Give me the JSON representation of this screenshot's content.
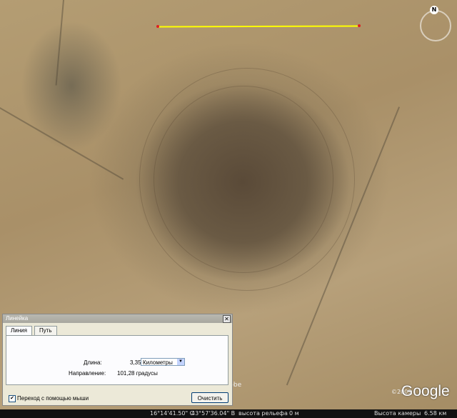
{
  "map": {
    "imagery_credit": "ital Globe",
    "logo": "Google",
    "copyright": "©2009"
  },
  "compass": {
    "north_label": "N"
  },
  "status_bar": {
    "latitude": "16°14'41.50\" С",
    "longitude": "43°57'36.04\" В",
    "elevation_label": "высота рельефа",
    "elevation_value": "0 м",
    "eye_alt_label": "Высота камеры",
    "eye_alt_value": "6.58 км"
  },
  "ruler_dialog": {
    "title": "Линейка",
    "close_glyph": "✕",
    "tabs": [
      {
        "label": "Линия"
      },
      {
        "label": "Путь"
      }
    ],
    "length_label": "Длина:",
    "length_value": "3,35",
    "unit_selected": "Километры",
    "direction_label": "Направление:",
    "direction_value": "101,28 градусы",
    "mouse_nav_label": "Переход с помощью мыши",
    "mouse_nav_checked": true,
    "clear_button": "Очистить"
  },
  "colors": {
    "ruler_line": "#ffff00",
    "ruler_endpoints": "#e02020"
  }
}
